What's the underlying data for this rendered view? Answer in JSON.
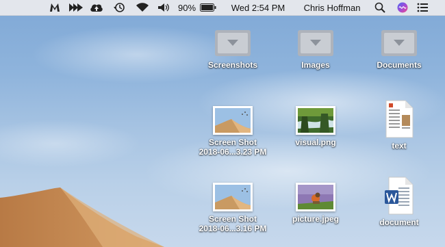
{
  "menubar": {
    "icons": [
      "malwarebytes-icon",
      "transfer-icon",
      "cloud-upload-icon",
      "time-machine-icon",
      "wifi-icon",
      "volume-icon"
    ],
    "battery_percent": "90%",
    "clock": "Wed 2:54 PM",
    "user": "Chris Hoffman",
    "right_icons": [
      "spotlight-search-icon",
      "siri-icon",
      "notification-center-icon"
    ]
  },
  "desktop": {
    "items": [
      {
        "label": "Screenshots",
        "kind": "folder"
      },
      {
        "label": "Images",
        "kind": "folder"
      },
      {
        "label": "Documents",
        "kind": "folder"
      },
      {
        "label_line1": "Screen Shot",
        "label_line2": "2018-06...3.23 PM",
        "kind": "screenshot"
      },
      {
        "label": "visual.png",
        "kind": "image"
      },
      {
        "label": "text",
        "kind": "document"
      },
      {
        "label_line1": "Screen Shot",
        "label_line2": "2018-06...3.16 PM",
        "kind": "screenshot"
      },
      {
        "label": "picture.jpeg",
        "kind": "image"
      },
      {
        "label": "document",
        "kind": "word-document"
      }
    ]
  },
  "colors": {
    "sky_top": "#7fa8d6",
    "sky_bottom": "#c7d8ec",
    "dune": "#c9905a",
    "menubar_bg": "#ececee",
    "folder_gray": "#a9aeb6",
    "word_blue": "#2b579a"
  }
}
